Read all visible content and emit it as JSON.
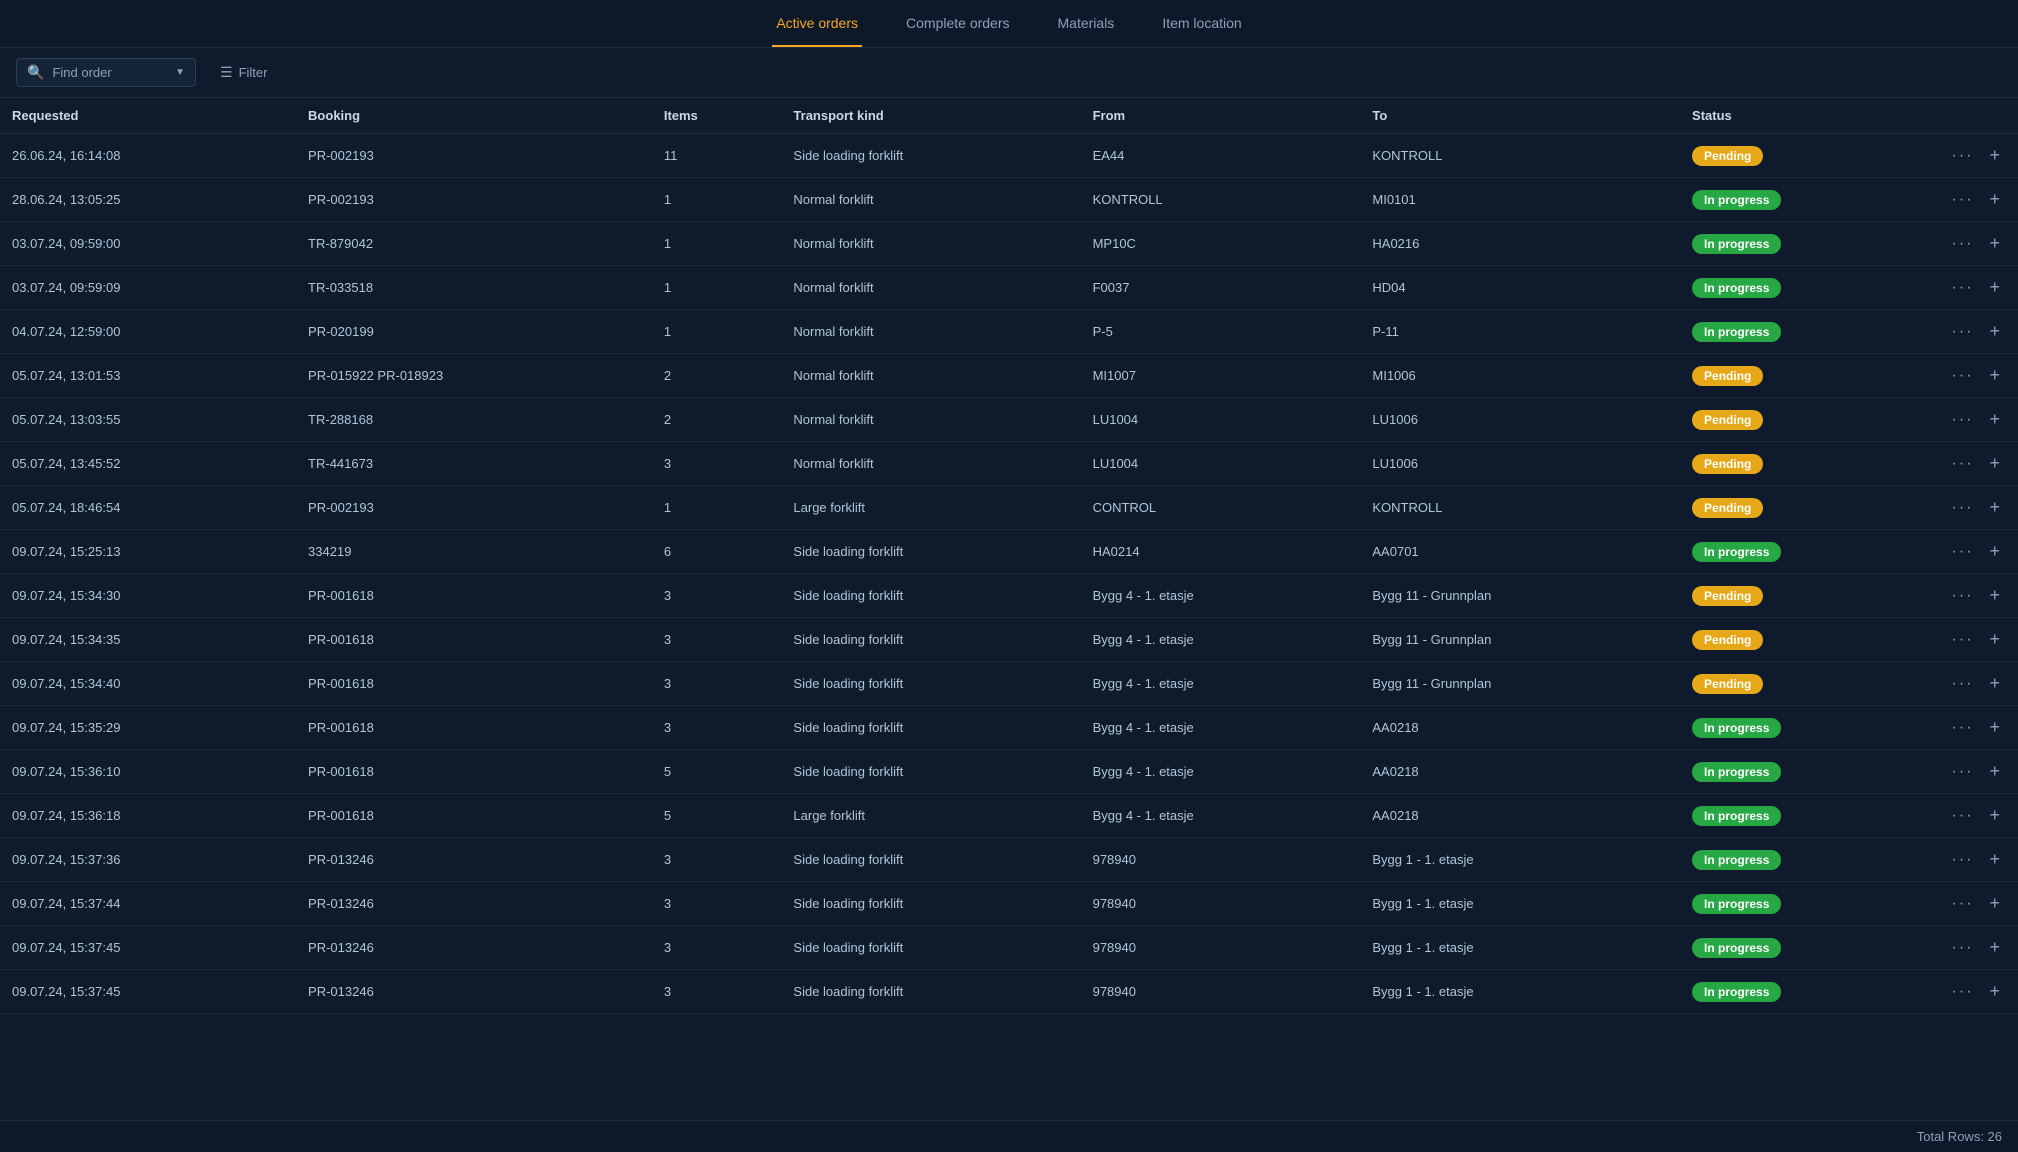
{
  "nav": {
    "tabs": [
      {
        "id": "active",
        "label": "Active orders",
        "active": true
      },
      {
        "id": "complete",
        "label": "Complete orders",
        "active": false
      },
      {
        "id": "materials",
        "label": "Materials",
        "active": false
      },
      {
        "id": "item-location",
        "label": "Item location",
        "active": false
      }
    ]
  },
  "toolbar": {
    "search_placeholder": "Find order",
    "filter_label": "Filter"
  },
  "table": {
    "columns": [
      "Requested",
      "Booking",
      "Items",
      "Transport kind",
      "From",
      "To",
      "Status"
    ],
    "rows": [
      {
        "requested": "26.06.24, 16:14:08",
        "booking": "PR-002193",
        "items": "11",
        "transport": "Side loading forklift",
        "from": "EA44",
        "to": "KONTROLL",
        "status": "Pending",
        "status_type": "pending"
      },
      {
        "requested": "28.06.24, 13:05:25",
        "booking": "PR-002193",
        "items": "1",
        "transport": "Normal forklift",
        "from": "KONTROLL",
        "to": "MI0101",
        "status": "In progress",
        "status_type": "inprogress"
      },
      {
        "requested": "03.07.24, 09:59:00",
        "booking": "TR-879042",
        "items": "1",
        "transport": "Normal forklift",
        "from": "MP10C",
        "to": "HA0216",
        "status": "In progress",
        "status_type": "inprogress"
      },
      {
        "requested": "03.07.24, 09:59:09",
        "booking": "TR-033518",
        "items": "1",
        "transport": "Normal forklift",
        "from": "F0037",
        "to": "HD04",
        "status": "In progress",
        "status_type": "inprogress"
      },
      {
        "requested": "04.07.24, 12:59:00",
        "booking": "PR-020199",
        "items": "1",
        "transport": "Normal forklift",
        "from": "P-5",
        "to": "P-11",
        "status": "In progress",
        "status_type": "inprogress"
      },
      {
        "requested": "05.07.24, 13:01:53",
        "booking": "PR-015922  PR-018923",
        "items": "2",
        "transport": "Normal forklift",
        "from": "MI1007",
        "to": "MI1006",
        "status": "Pending",
        "status_type": "pending"
      },
      {
        "requested": "05.07.24, 13:03:55",
        "booking": "TR-288168",
        "items": "2",
        "transport": "Normal forklift",
        "from": "LU1004",
        "to": "LU1006",
        "status": "Pending",
        "status_type": "pending"
      },
      {
        "requested": "05.07.24, 13:45:52",
        "booking": "TR-441673",
        "items": "3",
        "transport": "Normal forklift",
        "from": "LU1004",
        "to": "LU1006",
        "status": "Pending",
        "status_type": "pending"
      },
      {
        "requested": "05.07.24, 18:46:54",
        "booking": "PR-002193",
        "items": "1",
        "transport": "Large forklift",
        "from": "CONTROL",
        "to": "KONTROLL",
        "status": "Pending",
        "status_type": "pending"
      },
      {
        "requested": "09.07.24, 15:25:13",
        "booking": "334219",
        "items": "6",
        "transport": "Side loading forklift",
        "from": "HA0214",
        "to": "AA0701",
        "status": "In progress",
        "status_type": "inprogress"
      },
      {
        "requested": "09.07.24, 15:34:30",
        "booking": "PR-001618",
        "items": "3",
        "transport": "Side loading forklift",
        "from": "Bygg 4 - 1. etasje",
        "to": "Bygg 11 - Grunnplan",
        "status": "Pending",
        "status_type": "pending"
      },
      {
        "requested": "09.07.24, 15:34:35",
        "booking": "PR-001618",
        "items": "3",
        "transport": "Side loading forklift",
        "from": "Bygg 4 - 1. etasje",
        "to": "Bygg 11 - Grunnplan",
        "status": "Pending",
        "status_type": "pending"
      },
      {
        "requested": "09.07.24, 15:34:40",
        "booking": "PR-001618",
        "items": "3",
        "transport": "Side loading forklift",
        "from": "Bygg 4 - 1. etasje",
        "to": "Bygg 11 - Grunnplan",
        "status": "Pending",
        "status_type": "pending"
      },
      {
        "requested": "09.07.24, 15:35:29",
        "booking": "PR-001618",
        "items": "3",
        "transport": "Side loading forklift",
        "from": "Bygg 4 - 1. etasje",
        "to": "AA0218",
        "status": "In progress",
        "status_type": "inprogress"
      },
      {
        "requested": "09.07.24, 15:36:10",
        "booking": "PR-001618",
        "items": "5",
        "transport": "Side loading forklift",
        "from": "Bygg 4 - 1. etasje",
        "to": "AA0218",
        "status": "In progress",
        "status_type": "inprogress"
      },
      {
        "requested": "09.07.24, 15:36:18",
        "booking": "PR-001618",
        "items": "5",
        "transport": "Large forklift",
        "from": "Bygg 4 - 1. etasje",
        "to": "AA0218",
        "status": "In progress",
        "status_type": "inprogress"
      },
      {
        "requested": "09.07.24, 15:37:36",
        "booking": "PR-013246",
        "items": "3",
        "transport": "Side loading forklift",
        "from": "978940",
        "to": "Bygg 1 - 1. etasje",
        "status": "In progress",
        "status_type": "inprogress"
      },
      {
        "requested": "09.07.24, 15:37:44",
        "booking": "PR-013246",
        "items": "3",
        "transport": "Side loading forklift",
        "from": "978940",
        "to": "Bygg 1 - 1. etasje",
        "status": "In progress",
        "status_type": "inprogress"
      },
      {
        "requested": "09.07.24, 15:37:45",
        "booking": "PR-013246",
        "items": "3",
        "transport": "Side loading forklift",
        "from": "978940",
        "to": "Bygg 1 - 1. etasje",
        "status": "In progress",
        "status_type": "inprogress"
      },
      {
        "requested": "09.07.24, 15:37:45",
        "booking": "PR-013246",
        "items": "3",
        "transport": "Side loading forklift",
        "from": "978940",
        "to": "Bygg 1 - 1. etasje",
        "status": "In progress",
        "status_type": "inprogress"
      }
    ]
  },
  "footer": {
    "total_label": "Total Rows: 26"
  }
}
